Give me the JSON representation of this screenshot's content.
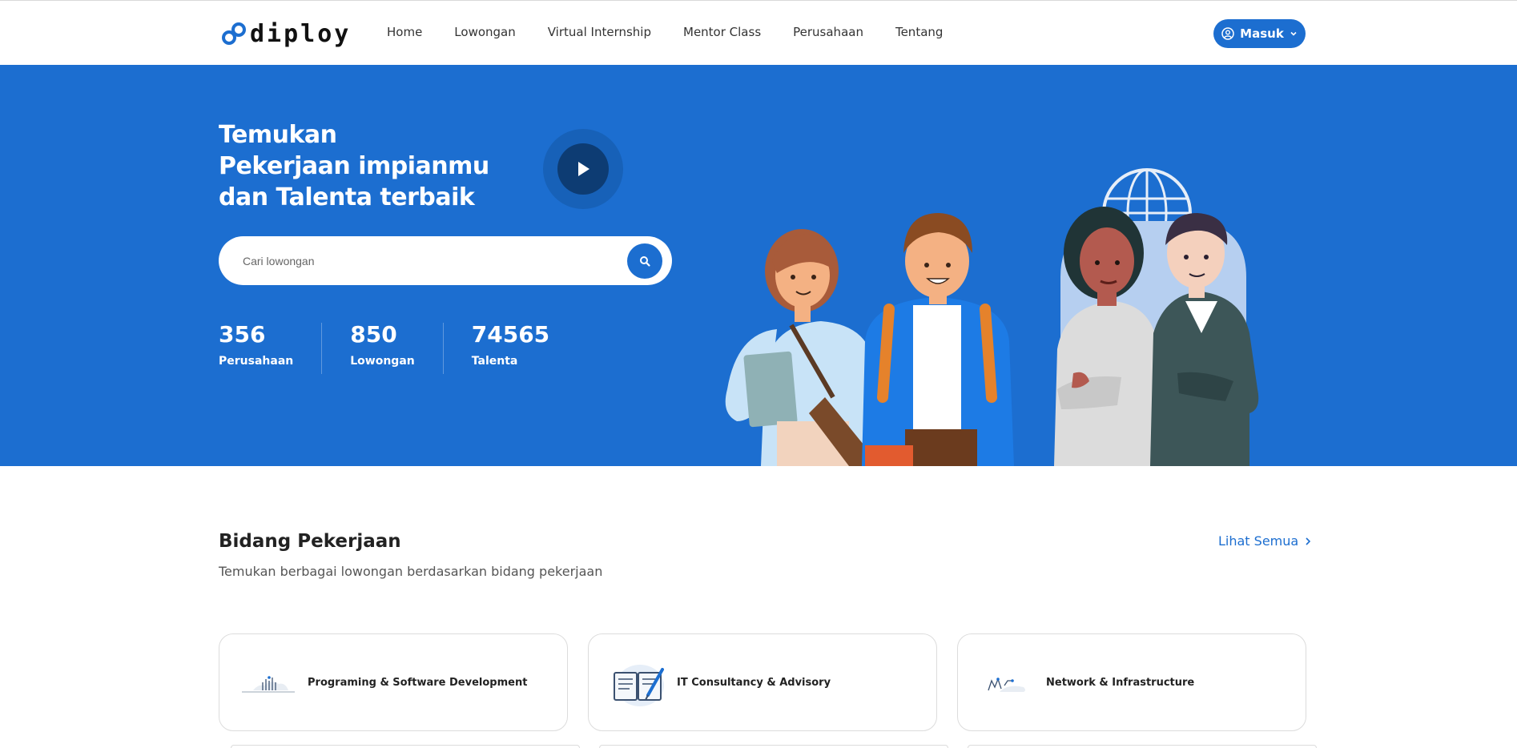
{
  "navbar": {
    "logo_text": "diploy",
    "links": [
      "Home",
      "Lowongan",
      "Virtual Internship",
      "Mentor Class",
      "Perusahaan",
      "Tentang"
    ],
    "login_label": "Masuk"
  },
  "hero": {
    "title_lines": [
      "Temukan",
      "Pekerjaan impianmu",
      "dan Talenta terbaik"
    ],
    "search_placeholder": "Cari lowongan",
    "stats": [
      {
        "value": "356",
        "label": "Perusahaan"
      },
      {
        "value": "850",
        "label": "Lowongan"
      },
      {
        "value": "74565",
        "label": "Talenta"
      }
    ]
  },
  "section": {
    "title": "Bidang Pekerjaan",
    "subtitle": "Temukan berbagai lowongan berdasarkan bidang pekerjaan",
    "see_all_label": "Lihat Semua"
  },
  "categories": [
    {
      "label": "Programing & Software Development",
      "icon": "software-development-icon"
    },
    {
      "label": "IT Consultancy & Advisory",
      "icon": "consultancy-icon"
    },
    {
      "label": "Network & Infrastructure",
      "icon": "network-icon"
    }
  ],
  "colors": {
    "primary": "#1c6ed0",
    "play_button": "#0d3c73"
  }
}
